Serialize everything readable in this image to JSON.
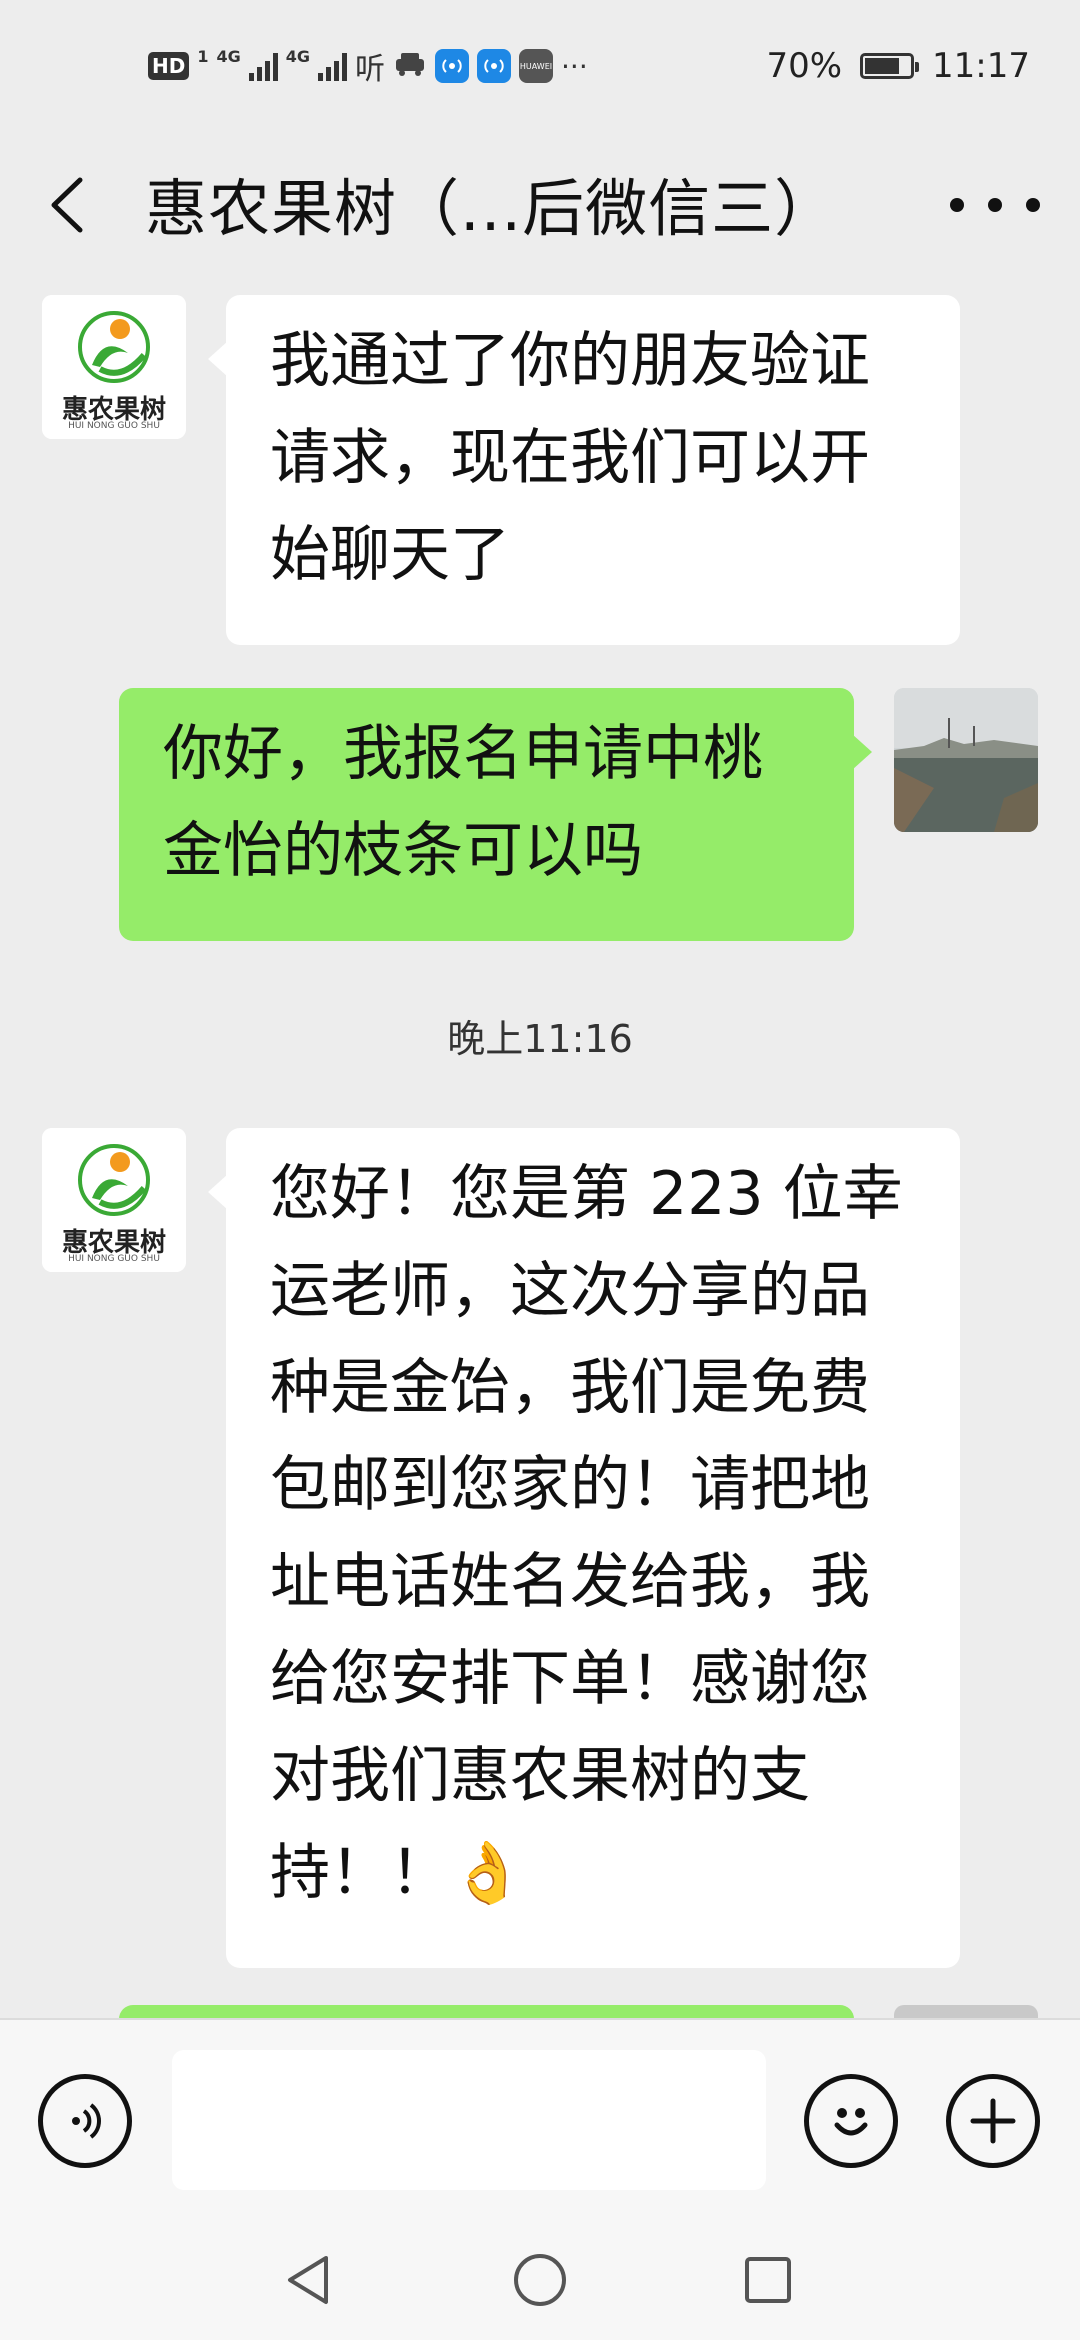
{
  "status_bar": {
    "hd": "HD",
    "sim_digit": "1",
    "net1": "4G",
    "net2": "4G",
    "listen": "听",
    "battery": "70%",
    "time": "11:17",
    "huawei": "HUAWEI",
    "dots": "···",
    "icons": [
      "car-icon",
      "hotspot-icon",
      "hotspot-icon",
      "huawei-icon"
    ]
  },
  "header": {
    "title": "惠农果树（...后微信三）",
    "back_icon": "chevron-left-icon",
    "more_icon": "more-icon"
  },
  "contact_avatar": {
    "logo_text": "惠农果树",
    "logo_subtext": "HUI NONG GUO SHU",
    "brand_green": "#3aa935",
    "brand_orange": "#f39a1e"
  },
  "messages": [
    {
      "side": "in",
      "text": "我通过了你的朋友验证\n请求，现在我们可以开\n始聊天了"
    },
    {
      "side": "out",
      "text": "你好，我报名申请中桃\n金怡的枝条可以吗"
    },
    {
      "side": "in",
      "text": "您好！您是第 223 位幸\n运老师，这次分享的品\n种是金饴，我们是免费\n包邮到您家的！请把地\n址电话姓名发给我，我\n给您安排下单！感谢您\n对我们惠农果树的支\n持！！👌"
    }
  ],
  "timestamp": "晚上11:16",
  "input_bar": {
    "placeholder": "",
    "voice_icon": "voice-icon",
    "emoji_icon": "emoji-icon",
    "plus_icon": "plus-icon"
  },
  "colors": {
    "background": "#ededed",
    "out_bubble": "#95ec69",
    "in_bubble": "#ffffff"
  }
}
